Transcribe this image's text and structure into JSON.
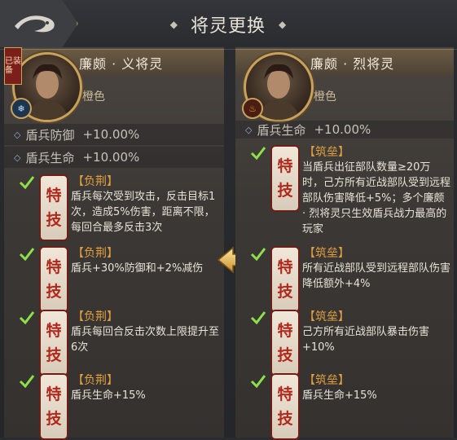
{
  "header": {
    "title": "将灵更换",
    "diamond": "◆"
  },
  "left": {
    "equipped_tag": "已装备",
    "hero_name": "廉颇 · 义将灵",
    "rarity": "橙色",
    "stats": [
      {
        "label": "盾兵防御",
        "value": "+10.00%"
      },
      {
        "label": "盾兵生命",
        "value": "+10.00%"
      }
    ],
    "skills": [
      {
        "title": "【负荆】",
        "desc": "盾兵每次受到攻击，反击目标1次，造成5%伤害，距离不限，每回合最多反击3次"
      },
      {
        "title": "【负荆】",
        "desc": "盾兵+30%防御和+2%减伤"
      },
      {
        "title": "【负荆】",
        "desc": "盾兵每回合反击次数上限提升至6次"
      },
      {
        "title": "【负荆】",
        "desc": "盾兵生命+15%"
      }
    ]
  },
  "right": {
    "hero_name": "廉颇 · 烈将灵",
    "rarity": "橙色",
    "stats": [
      {
        "label": "盾兵生命",
        "value": "+10.00%"
      }
    ],
    "skills": [
      {
        "title": "【筑垒】",
        "desc": "当盾兵出征部队数量≥20万时，己方所有近战部队受到远程部队伤害降低+5%；多个廉颇 · 烈将灵只生效盾兵战力最高的玩家"
      },
      {
        "title": "【筑垒】",
        "desc": "所有近战部队受到远程部队伤害降低额外+4%"
      },
      {
        "title": "【筑垒】",
        "desc": "己方所有近战部队暴击伤害+10%"
      },
      {
        "title": "【筑垒】",
        "desc": "盾兵生命+15%"
      }
    ]
  },
  "seal": {
    "top": "特",
    "bottom": "技"
  },
  "stat_marker": "◇"
}
